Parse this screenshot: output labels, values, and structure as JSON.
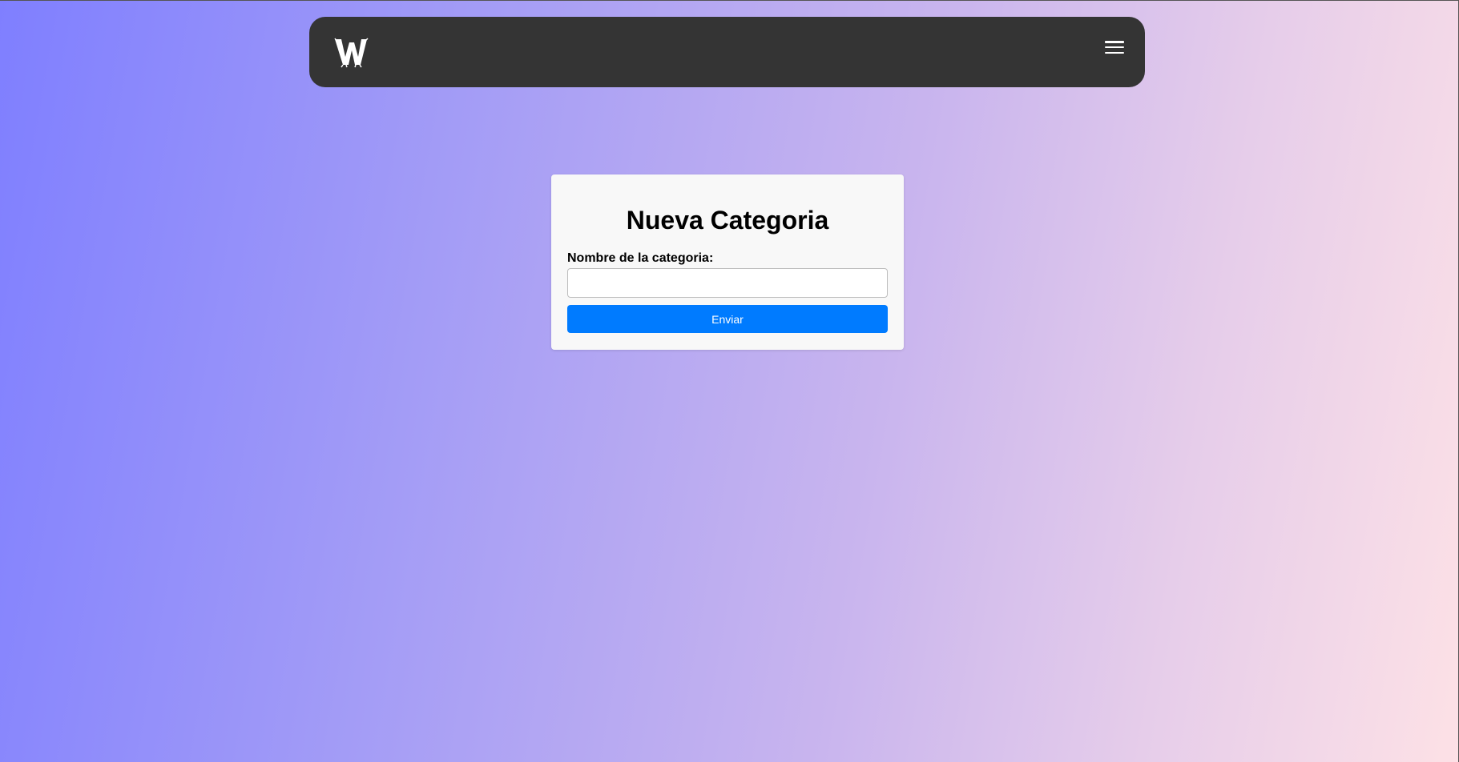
{
  "navbar": {
    "logo_icon": "w-logo-icon",
    "menu_icon": "hamburger-menu-icon"
  },
  "form": {
    "title": "Nueva Categoria",
    "name_label": "Nombre de la categoria:",
    "name_value": "",
    "name_placeholder": "",
    "submit_label": "Enviar"
  },
  "colors": {
    "navbar_bg": "#343434",
    "button_bg": "#007bff",
    "card_bg": "#f8f8f8",
    "gradient_start": "#7f7fff",
    "gradient_end": "#fde1e6"
  }
}
